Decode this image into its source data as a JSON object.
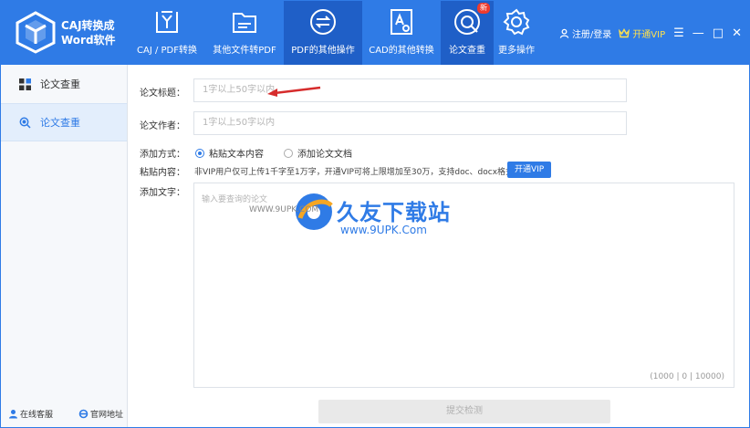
{
  "app": {
    "logo_line1": "CAJ转换成",
    "logo_line2": "Word软件"
  },
  "nav": [
    {
      "label": "CAJ / PDF转换",
      "icon": "pdf-convert-icon"
    },
    {
      "label": "其他文件转PDF",
      "icon": "folder-icon"
    },
    {
      "label": "PDF的其他操作",
      "icon": "exchange-icon"
    },
    {
      "label": "CAD的其他转换",
      "icon": "cad-icon"
    },
    {
      "label": "论文查重",
      "icon": "thesis-check-icon",
      "badge": "新"
    },
    {
      "label": "更多操作",
      "icon": "gear-icon"
    }
  ],
  "header_right": {
    "login": "注册/登录",
    "vip": "开通VIP",
    "menu_icon": "☰",
    "minimize_icon": "—",
    "maximize_icon": "□",
    "close_icon": "✕"
  },
  "sidebar": {
    "items": [
      {
        "label": "论文查重",
        "icon": "grid-icon"
      },
      {
        "label": "论文查重",
        "icon": "search-icon"
      }
    ],
    "footer": {
      "service": "在线客服",
      "website": "官网地址"
    }
  },
  "form": {
    "title_label": "论文标题：",
    "title_placeholder": "1字以上50字以内",
    "author_label": "论文作者：",
    "author_placeholder": "1字以上50字以内",
    "method_label": "添加方式：",
    "method_options": [
      "粘贴文本内容",
      "添加论文文档"
    ],
    "paste_label": "粘贴内容：",
    "paste_note": "非VIP用户仅可上传1千字至1万字，开通VIP可将上限增加至30万，支持doc、docx格式",
    "vip_button": "开通VIP",
    "text_label": "添加文字：",
    "text_placeholder": "输入要查询的论文",
    "counter": "(1000 | 0 | 10000)",
    "submit": "提交检测"
  },
  "watermark": {
    "title": "久友下载站",
    "url": "www.9UPK.Com",
    "small": "WWW.9UPK.COM"
  },
  "colors": {
    "primary": "#2f7be6",
    "active_nav": "#1f5fc7",
    "badge": "#ee3b2e",
    "vip_gold": "#ffe14d",
    "arrow": "#d62c2c"
  }
}
